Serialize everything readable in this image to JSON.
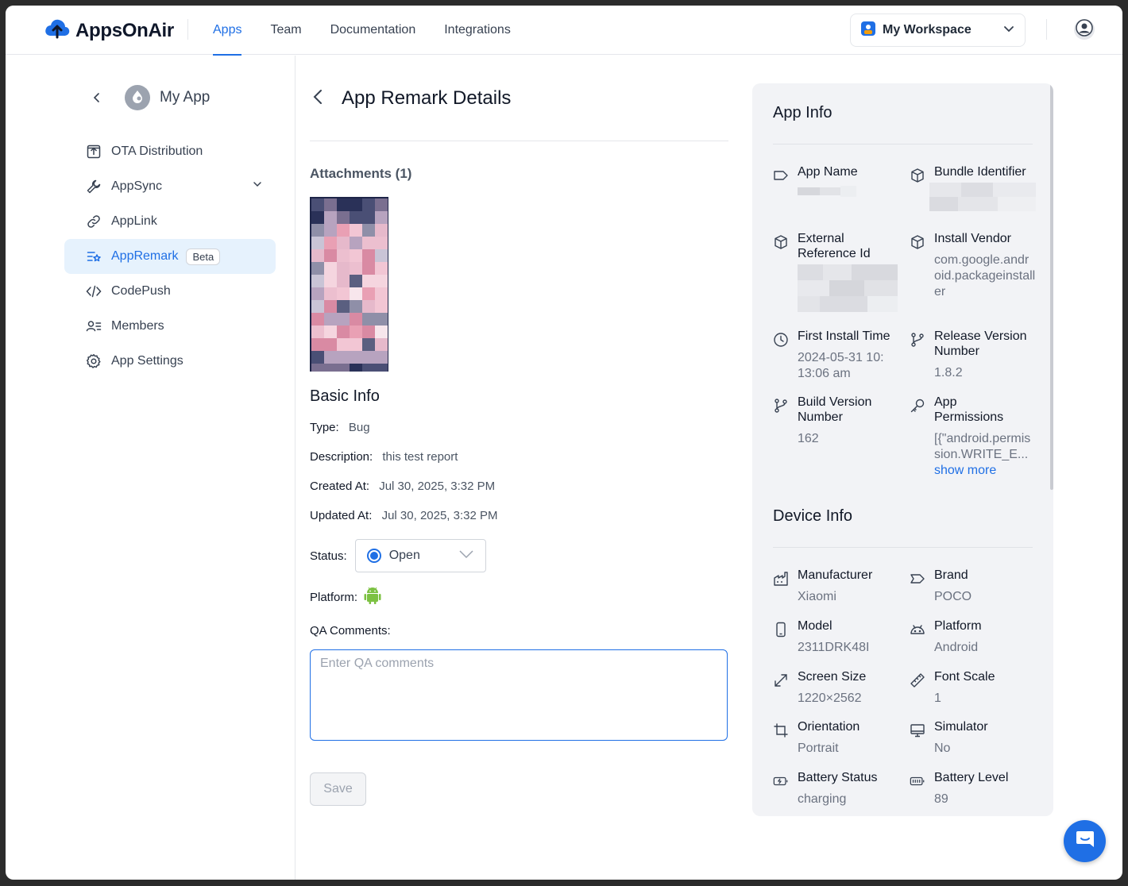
{
  "header": {
    "logo_text": "AppsOnAir",
    "nav": [
      "Apps",
      "Team",
      "Documentation",
      "Integrations"
    ],
    "workspace": "My Workspace"
  },
  "sidebar": {
    "app_name": "My App",
    "items": [
      {
        "label": "OTA Distribution",
        "icon": "upload-box-icon"
      },
      {
        "label": "AppSync",
        "icon": "wrench-icon"
      },
      {
        "label": "AppLink",
        "icon": "link-icon"
      },
      {
        "label": "AppRemark",
        "icon": "list-star-icon",
        "badge": "Beta"
      },
      {
        "label": "CodePush",
        "icon": "code-icon"
      },
      {
        "label": "Members",
        "icon": "members-icon"
      },
      {
        "label": "App Settings",
        "icon": "gear-icon"
      }
    ]
  },
  "main": {
    "title": "App Remark Details",
    "attachments_title": "Attachments (1)",
    "basic_info_title": "Basic Info",
    "type_label": "Type:",
    "type_value": "Bug",
    "description_label": "Description:",
    "description_value": "this test report",
    "created_label": "Created At:",
    "created_value": "Jul 30, 2025, 3:32 PM",
    "updated_label": "Updated At:",
    "updated_value": "Jul 30, 2025, 3:32 PM",
    "status_label": "Status:",
    "status_value": "Open",
    "platform_label": "Platform:",
    "platform_icon": "android-icon",
    "qa_label": "QA Comments:",
    "qa_placeholder": "Enter QA comments",
    "save_label": "Save"
  },
  "app_info": {
    "title": "App Info",
    "fields": {
      "app_name": {
        "label": "App Name",
        "value": ""
      },
      "bundle_identifier": {
        "label": "Bundle Identifier",
        "value": ""
      },
      "external_reference_id": {
        "label": "External Reference Id",
        "value": ""
      },
      "install_vendor": {
        "label": "Install Vendor",
        "value": "com.google.android.packageinstaller"
      },
      "first_install_time": {
        "label": "First Install Time",
        "value": "2024-05-31 10:13:06 am"
      },
      "release_version_number": {
        "label": "Release Version Number",
        "value": "1.8.2"
      },
      "build_version_number": {
        "label": "Build Version Number",
        "value": "162"
      },
      "app_permissions": {
        "label": "App Permissions",
        "value": "[{\"android.permission.WRITE_E...",
        "link": "show more"
      }
    }
  },
  "device_info": {
    "title": "Device Info",
    "fields": {
      "manufacturer": {
        "label": "Manufacturer",
        "value": "Xiaomi"
      },
      "brand": {
        "label": "Brand",
        "value": "POCO"
      },
      "model": {
        "label": "Model",
        "value": "2311DRK48I"
      },
      "platform": {
        "label": "Platform",
        "value": "Android"
      },
      "screen_size": {
        "label": "Screen Size",
        "value": "1220×2562"
      },
      "font_scale": {
        "label": "Font Scale",
        "value": "1"
      },
      "orientation": {
        "label": "Orientation",
        "value": "Portrait"
      },
      "simulator": {
        "label": "Simulator",
        "value": "No"
      },
      "battery_status": {
        "label": "Battery Status",
        "value": "charging"
      },
      "battery_level": {
        "label": "Battery Level",
        "value": "89"
      }
    }
  },
  "colors": {
    "accent": "#1f6fe5",
    "active_bg": "#e6f2fd",
    "panel_bg": "#f2f3f6",
    "android_green": "#7cc142"
  }
}
